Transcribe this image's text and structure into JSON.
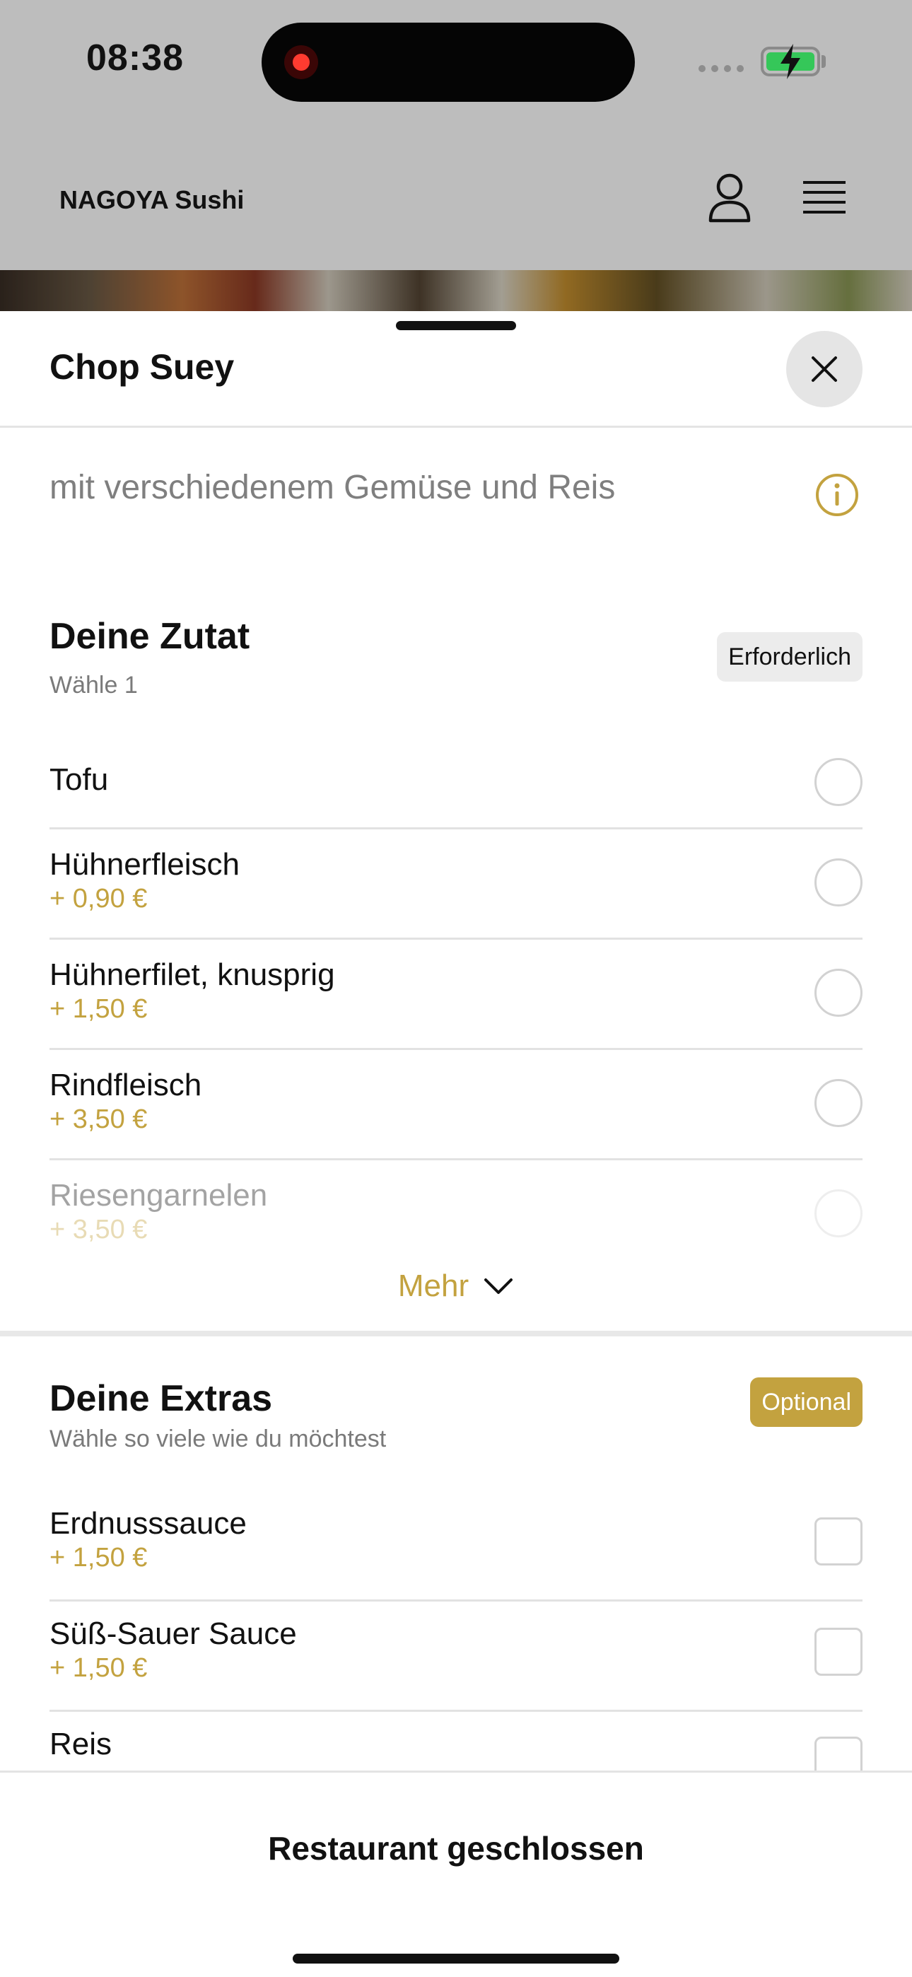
{
  "status_bar": {
    "time": "08:38"
  },
  "header": {
    "title": "NAGOYA Sushi"
  },
  "sheet": {
    "title": "Chop Suey",
    "description": "mit verschiedenem Gemüse und Reis"
  },
  "ingredients": {
    "title": "Deine Zutat",
    "subtitle": "Wähle 1",
    "badge": "Erforderlich",
    "options": [
      {
        "name": "Tofu",
        "price": ""
      },
      {
        "name": "Hühnerfleisch",
        "price": "+ 0,90 €"
      },
      {
        "name": "Hühnerfilet, knusprig",
        "price": "+ 1,50 €"
      },
      {
        "name": "Rindfleisch",
        "price": "+ 3,50 €"
      },
      {
        "name": "Riesengarnelen",
        "price": "+ 3,50 €"
      }
    ],
    "more_label": "Mehr"
  },
  "extras": {
    "title": "Deine Extras",
    "subtitle": "Wähle so viele wie du möchtest",
    "badge": "Optional",
    "options": [
      {
        "name": "Erdnusssauce",
        "price": "+ 1,50 €"
      },
      {
        "name": "Süß-Sauer Sauce",
        "price": "+ 1,50 €"
      },
      {
        "name": "Reis",
        "price": ""
      }
    ]
  },
  "footer": {
    "label": "Restaurant geschlossen"
  },
  "colors": {
    "accent": "#c3a23f",
    "overlay": "#bdbdbd",
    "text": "#111111",
    "muted": "#7f7f7f"
  },
  "icons": [
    "user-icon",
    "menu-icon",
    "close-icon",
    "info-icon",
    "chevron-down-icon"
  ]
}
